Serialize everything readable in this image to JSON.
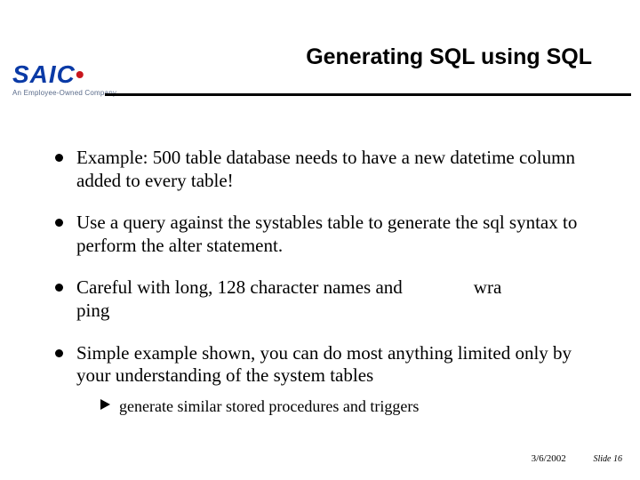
{
  "title": "Generating SQL using SQL",
  "logo": {
    "text_main": "SAIC",
    "accent_char": "•",
    "tagline": "An Employee-Owned Company"
  },
  "bullets": [
    {
      "text": "Example: 500 table database needs to have a new datetime column added to every table!"
    },
    {
      "text": "Use a query against the systables table to generate the sql syntax to perform the alter statement."
    },
    {
      "frag_a": "Careful with long, 128 character names and",
      "frag_b": "wra",
      "frag_c": "ping"
    },
    {
      "text": "Simple example shown, you can do most anything limited only by your understanding of the system tables",
      "sub": [
        {
          "text": "generate similar stored procedures and triggers"
        }
      ]
    }
  ],
  "footer": {
    "date": "3/6/2002",
    "slide_label": "Slide 16"
  }
}
